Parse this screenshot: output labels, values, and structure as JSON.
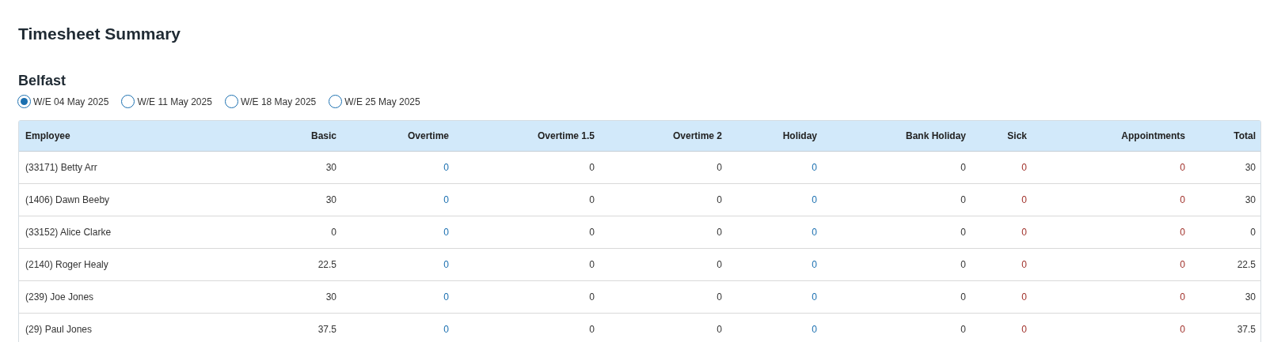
{
  "title": "Timesheet Summary",
  "location": "Belfast",
  "weeks": [
    {
      "label": "W/E 04 May 2025",
      "selected": true
    },
    {
      "label": "W/E 11 May 2025",
      "selected": false
    },
    {
      "label": "W/E 18 May 2025",
      "selected": false
    },
    {
      "label": "W/E 25 May 2025",
      "selected": false
    }
  ],
  "table": {
    "columns": [
      {
        "label": "Employee",
        "kind": "plain"
      },
      {
        "label": "Basic",
        "kind": "plain"
      },
      {
        "label": "Overtime",
        "kind": "info"
      },
      {
        "label": "Overtime 1.5",
        "kind": "plain"
      },
      {
        "label": "Overtime 2",
        "kind": "plain"
      },
      {
        "label": "Holiday",
        "kind": "info"
      },
      {
        "label": "Bank Holiday",
        "kind": "plain"
      },
      {
        "label": "Sick",
        "kind": "alert"
      },
      {
        "label": "Appointments",
        "kind": "alert"
      },
      {
        "label": "Total",
        "kind": "plain"
      }
    ],
    "rows": [
      [
        "(33171) Betty Arr",
        "30",
        "0",
        "0",
        "0",
        "0",
        "0",
        "0",
        "0",
        "30"
      ],
      [
        "(1406) Dawn Beeby",
        "30",
        "0",
        "0",
        "0",
        "0",
        "0",
        "0",
        "0",
        "30"
      ],
      [
        "(33152) Alice Clarke",
        "0",
        "0",
        "0",
        "0",
        "0",
        "0",
        "0",
        "0",
        "0"
      ],
      [
        "(2140) Roger Healy",
        "22.5",
        "0",
        "0",
        "0",
        "0",
        "0",
        "0",
        "0",
        "22.5"
      ],
      [
        "(239) Joe Jones",
        "30",
        "0",
        "0",
        "0",
        "0",
        "0",
        "0",
        "0",
        "30"
      ],
      [
        "(29) Paul Jones",
        "37.5",
        "0",
        "0",
        "0",
        "0",
        "0",
        "0",
        "0",
        "37.5"
      ]
    ]
  }
}
